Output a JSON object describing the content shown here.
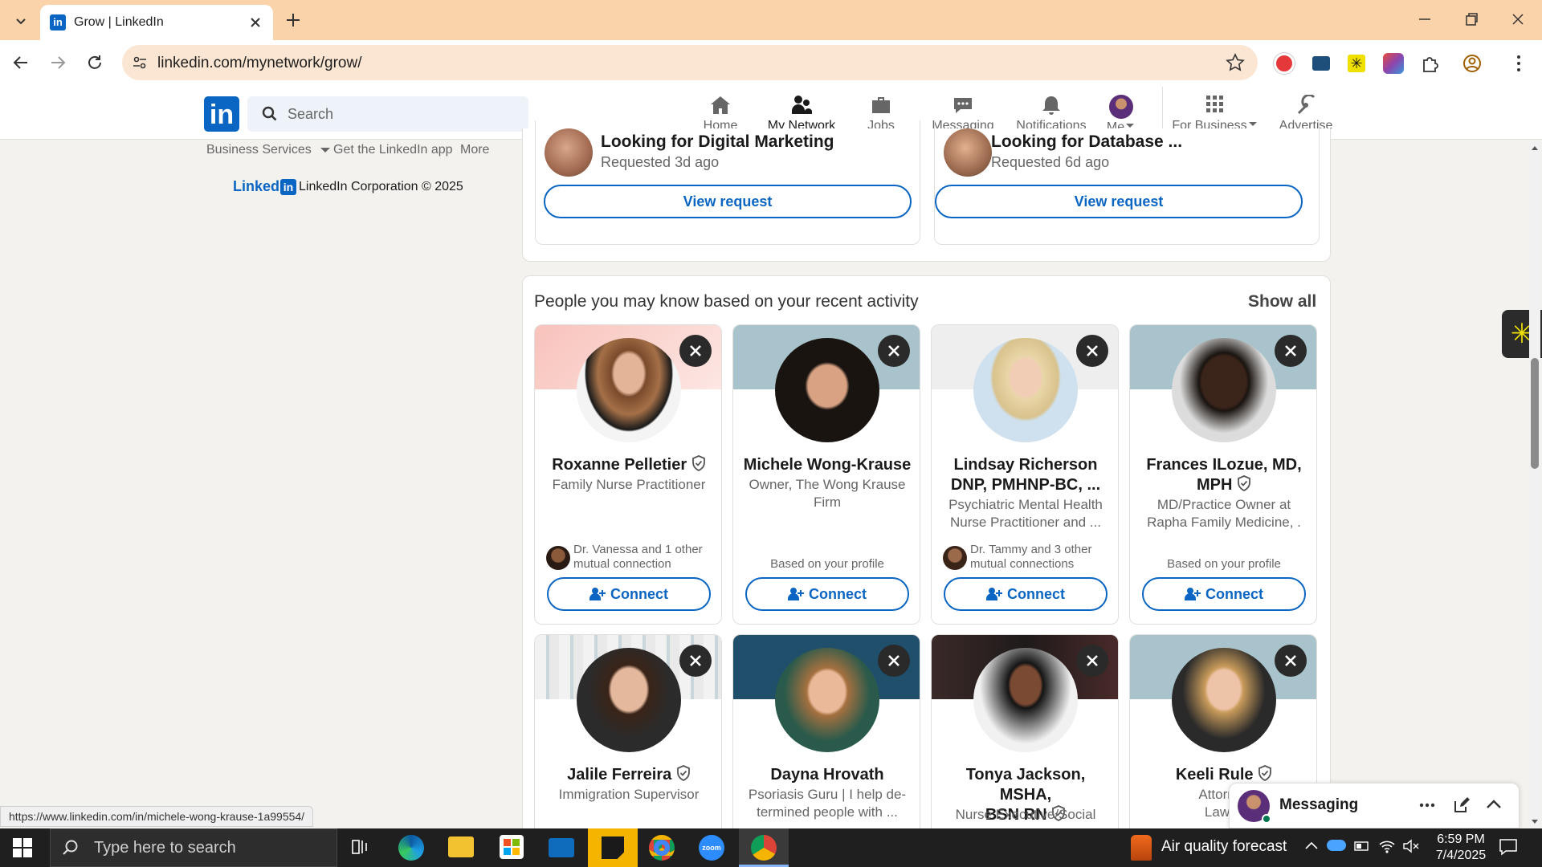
{
  "browser": {
    "tab_title": "Grow | LinkedIn",
    "url": "linkedin.com/mynetwork/grow/",
    "status_url": "https://www.linkedin.com/in/michele-wong-krause-1a99554/"
  },
  "header": {
    "search_placeholder": "Search",
    "nav": [
      {
        "label": "Home"
      },
      {
        "label": "My Network"
      },
      {
        "label": "Jobs"
      },
      {
        "label": "Messaging"
      },
      {
        "label": "Notifications"
      },
      {
        "label": "Me"
      },
      {
        "label": "For Business"
      },
      {
        "label": "Advertise"
      }
    ]
  },
  "sidebar": {
    "links": [
      "Business Services",
      "Get the LinkedIn app",
      "More"
    ],
    "logo_text": "Linked",
    "copyright": "LinkedIn Corporation © 2025"
  },
  "requests": [
    {
      "title": "Looking for Digital Marketing",
      "sub": "Requested 3d ago",
      "button": "View request"
    },
    {
      "title": "Looking for Database ...",
      "sub": "Requested 6d ago",
      "button": "View request"
    }
  ],
  "suggestions": {
    "title": "People you may know based on your recent activity",
    "show_all": "Show all",
    "connect_label": "Connect",
    "people": [
      {
        "name_l1": "Roxanne Pelletier",
        "name_l2": "",
        "headline_l1": "Family Nurse Practitioner",
        "headline_l2": "",
        "mutual_l1": "Dr. Vanessa and 1 other",
        "mutual_l2": "mutual connection",
        "basis": ""
      },
      {
        "name_l1": "Michele Wong-Krause",
        "name_l2": "",
        "headline_l1": "Owner, The Wong Krause",
        "headline_l2": "Firm",
        "mutual_l1": "",
        "mutual_l2": "",
        "basis": "Based on your profile"
      },
      {
        "name_l1": "Lindsay Richerson",
        "name_l2": "DNP, PMHNP-BC, ...",
        "headline_l1": "Psychiatric Mental Health",
        "headline_l2": "Nurse Practitioner and ...",
        "mutual_l1": "Dr. Tammy and 3 other",
        "mutual_l2": "mutual connections",
        "basis": ""
      },
      {
        "name_l1": "Frances ILozue, MD,",
        "name_l2": "MPH",
        "headline_l1": "MD/Practice Owner at",
        "headline_l2": "Rapha Family Medicine, .",
        "mutual_l1": "",
        "mutual_l2": "",
        "basis": "Based on your profile"
      },
      {
        "name_l1": "Jalile Ferreira",
        "name_l2": "",
        "headline_l1": "Immigration Supervisor",
        "headline_l2": ""
      },
      {
        "name_l1": "Dayna Hrovath",
        "name_l2": "",
        "headline_l1": "Psoriasis Guru | I help de-",
        "headline_l2": "termined people with ..."
      },
      {
        "name_l1": "Tonya Jackson, MSHA,",
        "name_l2": "BSN RN",
        "headline_l1": "Nurse Executive/Social",
        "headline_l2": ""
      },
      {
        "name_l1": "Keeli Rule",
        "name_l2": "",
        "headline_l1": "Attorney",
        "headline_l2": "Law/C"
      }
    ]
  },
  "messaging": {
    "label": "Messaging"
  },
  "taskbar": {
    "search_placeholder": "Type here to search",
    "weather": "Air quality forecast",
    "time": "6:59 PM",
    "date": "7/4/2025"
  },
  "colors": {
    "brand": "#0a66c2",
    "tabbar": "#fbd3ab",
    "omnibox": "#fbe6d3"
  }
}
